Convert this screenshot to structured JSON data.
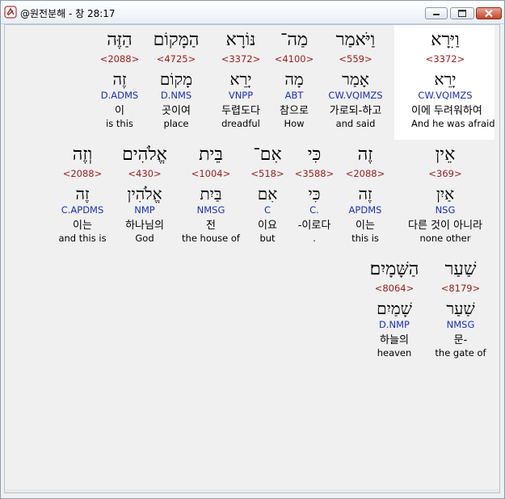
{
  "window": {
    "title": "@원전분해 - 창 28:17"
  },
  "rows": [
    [
      {
        "word": "וַיִּרָא",
        "strong": "<3372>",
        "lemma": "יָרֵא",
        "parse": "CW.VQIMZS",
        "kor": "이에 두려워하여",
        "eng": "And he was afraid",
        "highlight": true
      },
      {
        "word": "וַיֹּאמַר",
        "strong": "<559>",
        "lemma": "אָמַר",
        "parse": "CW.VQIMZS",
        "kor": "가로되-하고",
        "eng": "and said"
      },
      {
        "word": "מַה־",
        "strong": "<4100>",
        "lemma": "מָה",
        "parse": "ABT",
        "kor": "참으로",
        "eng": "How"
      },
      {
        "word": "נּוֹרָא",
        "strong": "<3372>",
        "lemma": "יָרֵא",
        "parse": "VNPP",
        "kor": "두렵도다",
        "eng": "dreadful"
      },
      {
        "word": "הַמָּקוֹם",
        "strong": "<4725>",
        "lemma": "מָקוֹם",
        "parse": "D.NMS",
        "kor": "곳이여",
        "eng": "place"
      },
      {
        "word": "הַזֶּה",
        "strong": "<2088>",
        "lemma": "זֶה",
        "parse": "D.ADMS",
        "kor": "이",
        "eng": "is this"
      }
    ],
    [
      {
        "word": "אֵין",
        "strong": "<369>",
        "lemma": "אַיִן",
        "parse": "NSG",
        "kor": "다른 것이 아니라",
        "eng": "none other"
      },
      {
        "word": "זֶה",
        "strong": "<2088>",
        "lemma": "זֶה",
        "parse": "APDMS",
        "kor": "이는",
        "eng": "this is"
      },
      {
        "word": "כִּי",
        "strong": "<3588>",
        "lemma": "כִּי",
        "parse": "C.",
        "kor": "-이로다",
        "eng": "."
      },
      {
        "word": "אִם־",
        "strong": "<518>",
        "lemma": "אִם",
        "parse": "C",
        "kor": "이요",
        "eng": "but"
      },
      {
        "word": "בֵּית",
        "strong": "<1004>",
        "lemma": "בַּיִת",
        "parse": "NMSG",
        "kor": "전",
        "eng": "the house of"
      },
      {
        "word": "אֱלֹהִים",
        "strong": "<430>",
        "lemma": "אֱלֹהִין",
        "parse": "NMP",
        "kor": "하나님의",
        "eng": "God"
      },
      {
        "word": "וְזֶה",
        "strong": "<2088>",
        "lemma": "זֶה",
        "parse": "C.APDMS",
        "kor": "이는",
        "eng": "and this is"
      }
    ],
    [
      {
        "word": "שַׁעַר",
        "strong": "<8179>",
        "lemma": "שַׁעַר",
        "parse": "NMSG",
        "kor": "문-",
        "eng": "the gate of"
      },
      {
        "word": "הַשָּׁמָיִם׃",
        "strong": "<8064>",
        "lemma": "שָׁמַיִם",
        "parse": "D.NMP",
        "kor": "하늘의",
        "eng": "heaven"
      }
    ]
  ]
}
